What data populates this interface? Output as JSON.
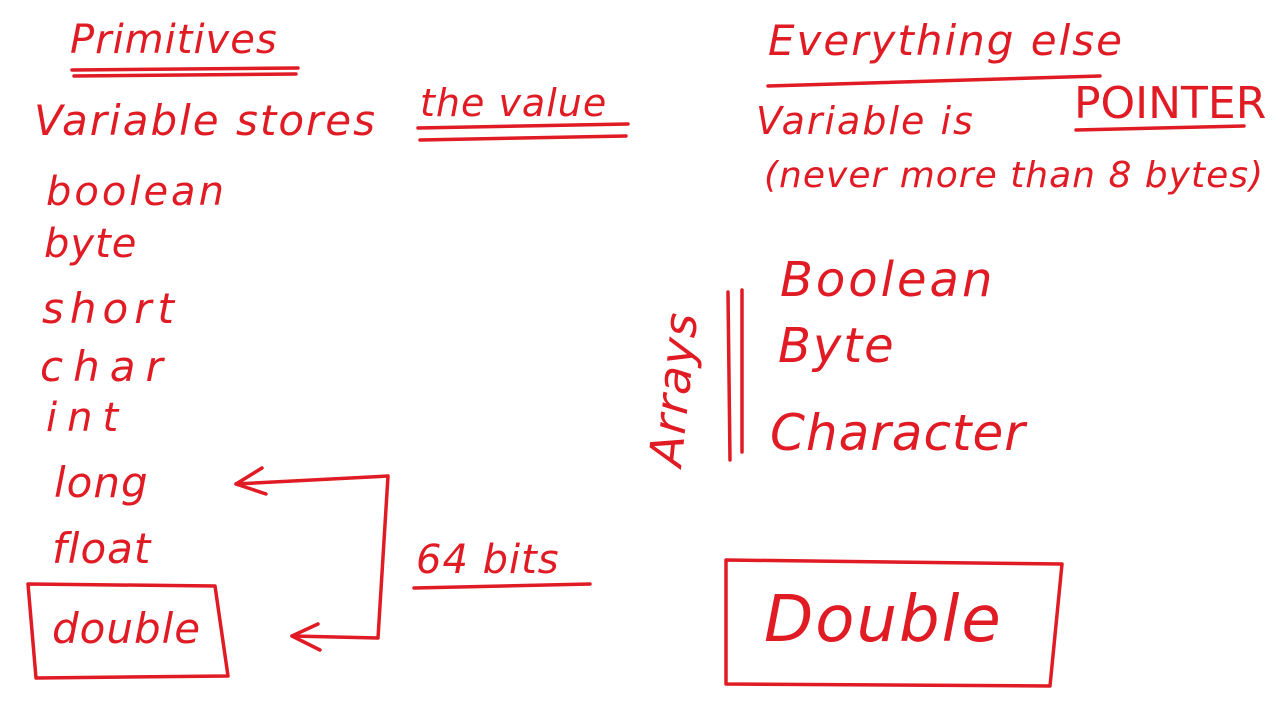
{
  "ink_color": "#e01b24",
  "left": {
    "heading": "Primitives",
    "subtitle_prefix": "Variable stores",
    "subtitle_emphasis": "the value",
    "types": [
      "boolean",
      "byte",
      "short",
      "char",
      "int",
      "long",
      "float",
      "double"
    ],
    "note": "64 bits"
  },
  "right": {
    "heading": "Everything else",
    "line1_prefix": "Variable is",
    "line1_emphasis": "POINTER",
    "line2": "(never more than 8 bytes)",
    "side_label": "Arrays",
    "types": [
      "Boolean",
      "Byte",
      "Character"
    ],
    "boxed_type": "Double"
  }
}
